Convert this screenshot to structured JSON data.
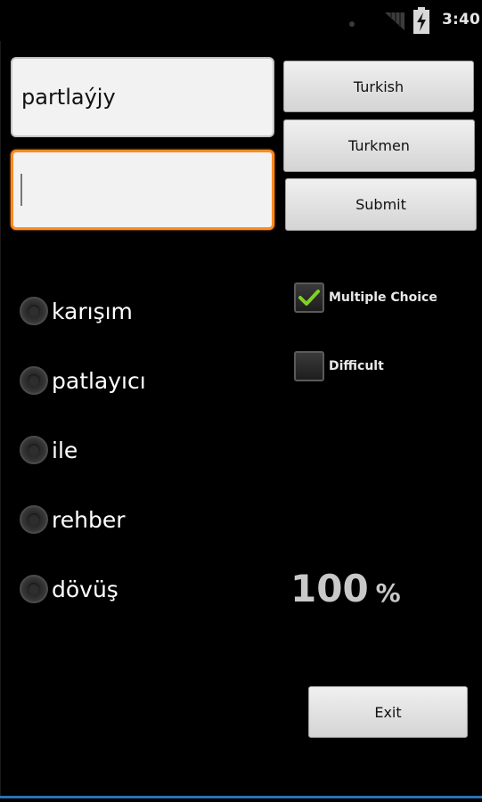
{
  "status_bar": {
    "time": "3:40",
    "icons": [
      "signal-icon",
      "battery-charging-icon"
    ]
  },
  "fields": {
    "source_word": "partlaýjy",
    "answer_value": ""
  },
  "buttons": {
    "turkish": "Turkish",
    "turkmen": "Turkmen",
    "submit": "Submit",
    "exit": "Exit"
  },
  "options": [
    {
      "label": "karışım",
      "selected": false
    },
    {
      "label": "patlayıcı",
      "selected": false
    },
    {
      "label": "ile",
      "selected": false
    },
    {
      "label": "rehber",
      "selected": false
    },
    {
      "label": "dövüş",
      "selected": false
    }
  ],
  "checkboxes": {
    "multiple_choice": {
      "label": "Multiple Choice",
      "checked": true
    },
    "difficult": {
      "label": "Difficult",
      "checked": false
    }
  },
  "score": {
    "value": "100",
    "unit": "%"
  },
  "colors": {
    "focus_border": "#ff8a1f",
    "check_mark": "#7ed321",
    "bottom_line": "#2e6fb2"
  }
}
